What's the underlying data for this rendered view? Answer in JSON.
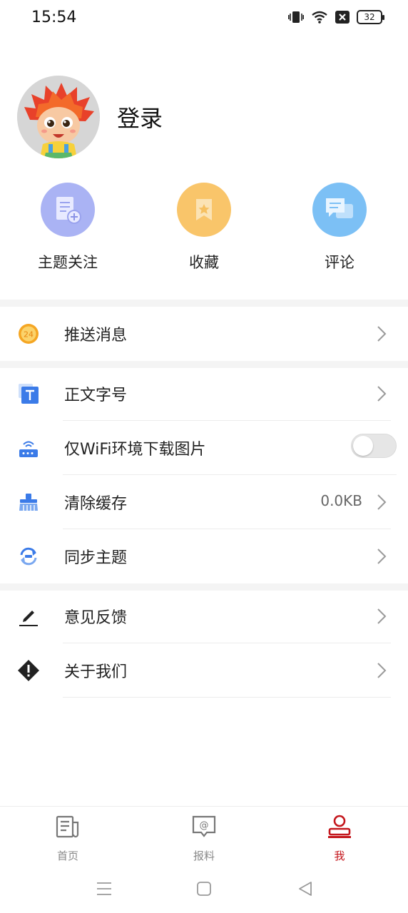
{
  "status_bar": {
    "time": "15:54",
    "battery": "32",
    "icons": [
      "vibrate-icon",
      "wifi-icon",
      "sim-off-icon",
      "battery-icon"
    ]
  },
  "profile": {
    "login_label": "登录",
    "avatar_icon": "mascot-avatar"
  },
  "quick_actions": [
    {
      "label": "主题关注",
      "icon": "add-topic-icon",
      "color": "#a9b2f3"
    },
    {
      "label": "收藏",
      "icon": "bookmark-icon",
      "color": "#f9c56a"
    },
    {
      "label": "评论",
      "icon": "comment-icon",
      "color": "#7cc0f5"
    }
  ],
  "settings": {
    "push": {
      "label": "推送消息",
      "icon": "push-24-icon"
    },
    "font_size": {
      "label": "正文字号",
      "icon": "text-size-icon"
    },
    "wifi_images": {
      "label": "仅WiFi环境下载图片",
      "icon": "router-icon",
      "enabled": false
    },
    "clear_cache": {
      "label": "清除缓存",
      "value": "0.0KB",
      "icon": "broom-icon"
    },
    "sync_theme": {
      "label": "同步主题",
      "icon": "sync-icon"
    },
    "feedback": {
      "label": "意见反馈",
      "icon": "pencil-icon"
    },
    "about": {
      "label": "关于我们",
      "icon": "info-diamond-icon"
    }
  },
  "tabs": [
    {
      "label": "首页",
      "icon": "newspaper-icon",
      "active": false
    },
    {
      "label": "报料",
      "icon": "report-icon",
      "active": false
    },
    {
      "label": "我",
      "icon": "person-icon",
      "active": true
    }
  ],
  "colors": {
    "accent": "#c4161c",
    "push_orange": "#f5a623",
    "blue_icon": "#3b7be8"
  }
}
